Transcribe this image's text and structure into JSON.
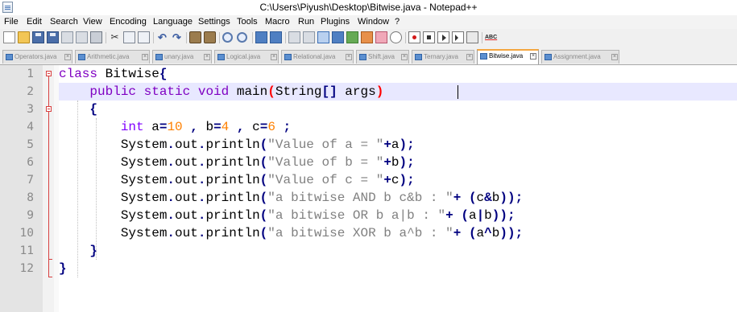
{
  "window": {
    "title": "C:\\Users\\Piyush\\Desktop\\Bitwise.java - Notepad++"
  },
  "menu": [
    {
      "label": "File"
    },
    {
      "label": "Edit"
    },
    {
      "label": "Search"
    },
    {
      "label": "View"
    },
    {
      "label": "Encoding"
    },
    {
      "label": "Language"
    },
    {
      "label": "Settings"
    },
    {
      "label": "Tools"
    },
    {
      "label": "Macro"
    },
    {
      "label": "Run"
    },
    {
      "label": "Plugins"
    },
    {
      "label": "Window"
    },
    {
      "label": "?"
    }
  ],
  "toolbar": {
    "spell_label": "ABC"
  },
  "tabs": [
    {
      "label": "Operators.java",
      "active": false
    },
    {
      "label": "Arithmetic.java",
      "active": false
    },
    {
      "label": "unary.java",
      "active": false
    },
    {
      "label": "Logical.java",
      "active": false
    },
    {
      "label": "Relational.java",
      "active": false
    },
    {
      "label": "Shift.java",
      "active": false
    },
    {
      "label": "Ternary.java",
      "active": false
    },
    {
      "label": "Bitwise.java",
      "active": true
    },
    {
      "label": "Assignment.java",
      "active": false
    }
  ],
  "tab_close_glyph": "×",
  "editor": {
    "current_line": 2,
    "lines": [
      {
        "no": "1",
        "tokens": [
          [
            "kw",
            "class"
          ],
          [
            "def",
            " Bitwise"
          ],
          [
            "op",
            "{"
          ]
        ]
      },
      {
        "no": "2",
        "tokens": [
          [
            "def",
            "    "
          ],
          [
            "kw",
            "public"
          ],
          [
            "def",
            " "
          ],
          [
            "kw",
            "static"
          ],
          [
            "def",
            " "
          ],
          [
            "kw",
            "void"
          ],
          [
            "def",
            " main"
          ],
          [
            "ph",
            "("
          ],
          [
            "def",
            "String"
          ],
          [
            "op",
            "[]"
          ],
          [
            "def",
            " args"
          ],
          [
            "ph",
            ")"
          ]
        ]
      },
      {
        "no": "3",
        "tokens": [
          [
            "def",
            "    "
          ],
          [
            "op",
            "{"
          ]
        ]
      },
      {
        "no": "4",
        "tokens": [
          [
            "def",
            "        "
          ],
          [
            "type",
            "int"
          ],
          [
            "def",
            " a"
          ],
          [
            "op",
            "="
          ],
          [
            "num",
            "10"
          ],
          [
            "def",
            " "
          ],
          [
            "op",
            ","
          ],
          [
            "def",
            " b"
          ],
          [
            "op",
            "="
          ],
          [
            "num",
            "4"
          ],
          [
            "def",
            " "
          ],
          [
            "op",
            ","
          ],
          [
            "def",
            " c"
          ],
          [
            "op",
            "="
          ],
          [
            "num",
            "6"
          ],
          [
            "def",
            " "
          ],
          [
            "op",
            ";"
          ]
        ]
      },
      {
        "no": "5",
        "tokens": [
          [
            "def",
            "        System"
          ],
          [
            "op",
            "."
          ],
          [
            "def",
            "out"
          ],
          [
            "op",
            "."
          ],
          [
            "def",
            "println"
          ],
          [
            "op",
            "("
          ],
          [
            "str",
            "\"Value of a = \""
          ],
          [
            "op",
            "+"
          ],
          [
            "def",
            "a"
          ],
          [
            "op",
            ");"
          ]
        ]
      },
      {
        "no": "6",
        "tokens": [
          [
            "def",
            "        System"
          ],
          [
            "op",
            "."
          ],
          [
            "def",
            "out"
          ],
          [
            "op",
            "."
          ],
          [
            "def",
            "println"
          ],
          [
            "op",
            "("
          ],
          [
            "str",
            "\"Value of b = \""
          ],
          [
            "op",
            "+"
          ],
          [
            "def",
            "b"
          ],
          [
            "op",
            ");"
          ]
        ]
      },
      {
        "no": "7",
        "tokens": [
          [
            "def",
            "        System"
          ],
          [
            "op",
            "."
          ],
          [
            "def",
            "out"
          ],
          [
            "op",
            "."
          ],
          [
            "def",
            "println"
          ],
          [
            "op",
            "("
          ],
          [
            "str",
            "\"Value of c = \""
          ],
          [
            "op",
            "+"
          ],
          [
            "def",
            "c"
          ],
          [
            "op",
            ");"
          ]
        ]
      },
      {
        "no": "8",
        "tokens": [
          [
            "def",
            "        System"
          ],
          [
            "op",
            "."
          ],
          [
            "def",
            "out"
          ],
          [
            "op",
            "."
          ],
          [
            "def",
            "println"
          ],
          [
            "op",
            "("
          ],
          [
            "str",
            "\"a bitwise AND b c&b : \""
          ],
          [
            "op",
            "+"
          ],
          [
            "def",
            " "
          ],
          [
            "op",
            "("
          ],
          [
            "def",
            "c"
          ],
          [
            "op",
            "&"
          ],
          [
            "def",
            "b"
          ],
          [
            "op",
            "));"
          ]
        ]
      },
      {
        "no": "9",
        "tokens": [
          [
            "def",
            "        System"
          ],
          [
            "op",
            "."
          ],
          [
            "def",
            "out"
          ],
          [
            "op",
            "."
          ],
          [
            "def",
            "println"
          ],
          [
            "op",
            "("
          ],
          [
            "str",
            "\"a bitwise OR b a|b : \""
          ],
          [
            "op",
            "+"
          ],
          [
            "def",
            " "
          ],
          [
            "op",
            "("
          ],
          [
            "def",
            "a"
          ],
          [
            "op",
            "|"
          ],
          [
            "def",
            "b"
          ],
          [
            "op",
            "));"
          ]
        ]
      },
      {
        "no": "10",
        "tokens": [
          [
            "def",
            "        System"
          ],
          [
            "op",
            "."
          ],
          [
            "def",
            "out"
          ],
          [
            "op",
            "."
          ],
          [
            "def",
            "println"
          ],
          [
            "op",
            "("
          ],
          [
            "str",
            "\"a bitwise XOR b a^b : \""
          ],
          [
            "op",
            "+"
          ],
          [
            "def",
            " "
          ],
          [
            "op",
            "("
          ],
          [
            "def",
            "a"
          ],
          [
            "op",
            "^"
          ],
          [
            "def",
            "b"
          ],
          [
            "op",
            "));"
          ]
        ]
      },
      {
        "no": "11",
        "tokens": [
          [
            "def",
            "    "
          ],
          [
            "op",
            "}"
          ]
        ]
      },
      {
        "no": "12",
        "tokens": [
          [
            "op",
            "}"
          ]
        ]
      }
    ]
  }
}
